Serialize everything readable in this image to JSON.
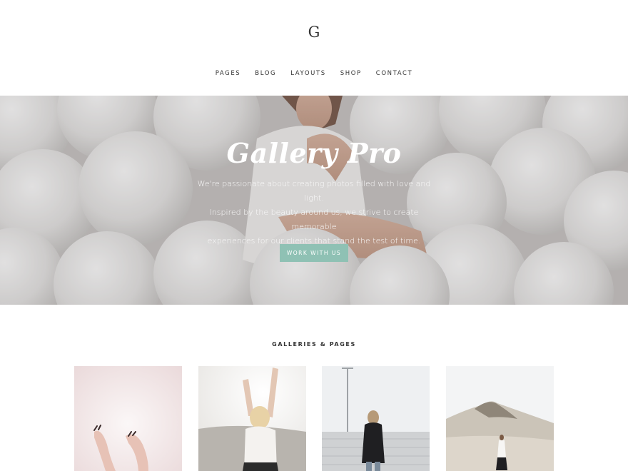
{
  "header": {
    "logo": "G",
    "nav": [
      "PAGES",
      "BLOG",
      "LAYOUTS",
      "SHOP",
      "CONTACT"
    ]
  },
  "hero": {
    "title": "Gallery Pro",
    "description_lines": [
      "We're passionate about creating photos filled with love and light.",
      "Inspired by the beauty around us, we strive to create memorable",
      "experiences for our clients that stand the test of time."
    ],
    "button_label": "WORK WITH US"
  },
  "section": {
    "title": "GALLERIES & PAGES"
  },
  "colors": {
    "accent": "#8fc1b4",
    "text": "#333333",
    "background": "#ffffff"
  }
}
